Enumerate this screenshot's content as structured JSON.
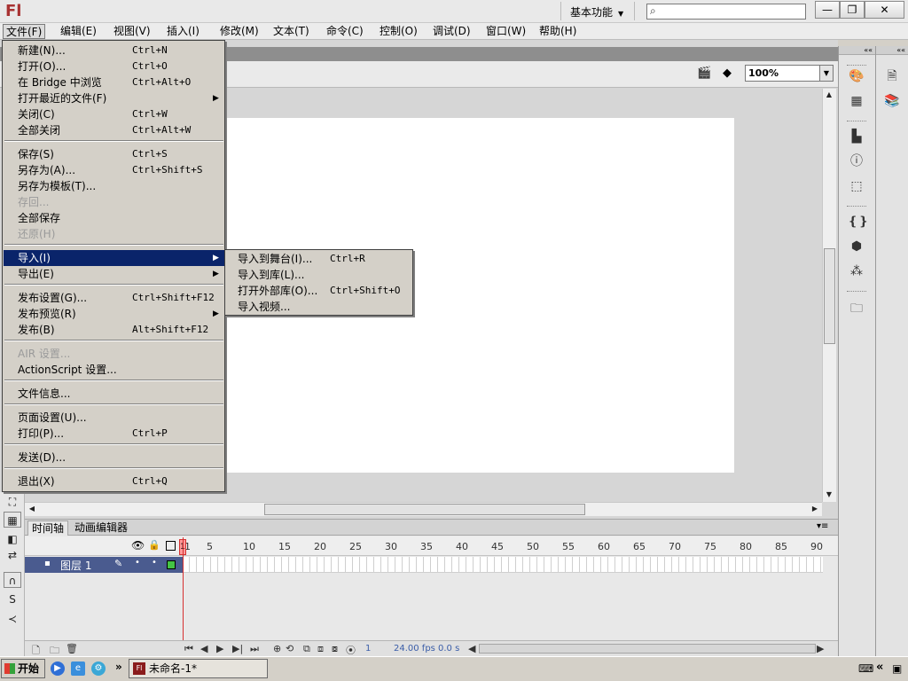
{
  "app": {
    "logo": "Fl",
    "workspace_label": "基本功能",
    "search_placeholder": "",
    "win_min": "—",
    "win_restore": "❐",
    "win_close": "✕"
  },
  "menubar": [
    "文件(F)",
    "编辑(E)",
    "视图(V)",
    "插入(I)",
    "修改(M)",
    "文本(T)",
    "命令(C)",
    "控制(O)",
    "调试(D)",
    "窗口(W)",
    "帮助(H)"
  ],
  "file_menu": {
    "items": [
      {
        "label": "新建(N)...",
        "shortcut": "Ctrl+N"
      },
      {
        "label": "打开(O)...",
        "shortcut": "Ctrl+O"
      },
      {
        "label": "在 Bridge 中浏览",
        "shortcut": "Ctrl+Alt+O"
      },
      {
        "label": "打开最近的文件(F)",
        "shortcut": ""
      },
      {
        "label": "关闭(C)",
        "shortcut": "Ctrl+W"
      },
      {
        "label": "全部关闭",
        "shortcut": "Ctrl+Alt+W"
      },
      {
        "label": "保存(S)",
        "shortcut": "Ctrl+S"
      },
      {
        "label": "另存为(A)...",
        "shortcut": "Ctrl+Shift+S"
      },
      {
        "label": "另存为模板(T)...",
        "shortcut": ""
      },
      {
        "label": "存回...",
        "shortcut": ""
      },
      {
        "label": "全部保存",
        "shortcut": ""
      },
      {
        "label": "还原(H)",
        "shortcut": ""
      },
      {
        "label": "导入(I)",
        "shortcut": ""
      },
      {
        "label": "导出(E)",
        "shortcut": ""
      },
      {
        "label": "发布设置(G)...",
        "shortcut": "Ctrl+Shift+F12"
      },
      {
        "label": "发布预览(R)",
        "shortcut": ""
      },
      {
        "label": "发布(B)",
        "shortcut": "Alt+Shift+F12"
      },
      {
        "label": "AIR 设置...",
        "shortcut": ""
      },
      {
        "label": "ActionScript 设置...",
        "shortcut": ""
      },
      {
        "label": "文件信息...",
        "shortcut": ""
      },
      {
        "label": "页面设置(U)...",
        "shortcut": ""
      },
      {
        "label": "打印(P)...",
        "shortcut": "Ctrl+P"
      },
      {
        "label": "发送(D)...",
        "shortcut": ""
      },
      {
        "label": "退出(X)",
        "shortcut": "Ctrl+Q"
      }
    ]
  },
  "import_submenu": {
    "items": [
      {
        "label": "导入到舞台(I)...",
        "shortcut": "Ctrl+R"
      },
      {
        "label": "导入到库(L)...",
        "shortcut": ""
      },
      {
        "label": "打开外部库(O)...",
        "shortcut": "Ctrl+Shift+O"
      },
      {
        "label": "导入视频...",
        "shortcut": ""
      }
    ]
  },
  "editbar": {
    "zoom": "100%"
  },
  "timeline": {
    "tabs": [
      "时间轴",
      "动画编辑器"
    ],
    "frame_numbers": [
      "1",
      "5",
      "10",
      "15",
      "20",
      "25",
      "30",
      "35",
      "40",
      "45",
      "50",
      "55",
      "60",
      "65",
      "70",
      "75",
      "80",
      "85",
      "90"
    ],
    "layer_name": "图层 1",
    "current_frame": "1",
    "fps": "24.00 fps",
    "time": "0.0 s"
  },
  "taskbar": {
    "start_label": "开始",
    "app_label": "未命名-1*",
    "app_icon": "Fl",
    "more": "»",
    "tray_arrow": "«"
  }
}
